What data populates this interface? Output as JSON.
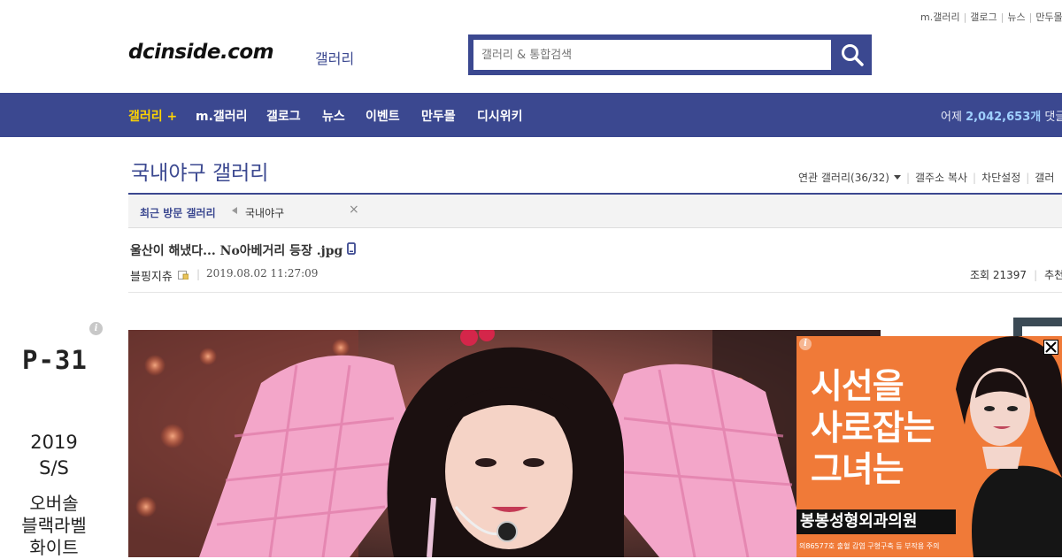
{
  "util_links": [
    "m.갤러리",
    "갤로그",
    "뉴스",
    "만두몰"
  ],
  "logo": {
    "main": "dcinside.com",
    "sub": "갤러리"
  },
  "search": {
    "placeholder": "갤러리 & 통합검색"
  },
  "nav": {
    "items": [
      "갤러리 +",
      "m.갤러리",
      "갤로그",
      "뉴스",
      "이벤트",
      "만두몰",
      "디시위키"
    ],
    "stats_label": "어제",
    "stats_value": "2,042,653개",
    "stats_suffix": "댓글"
  },
  "gallery": {
    "title": "국내야구 갤러리",
    "tools": {
      "related": "연관 갤러리(36/32)",
      "copy": "갤주소 복사",
      "block": "차단설정",
      "more": "갤러"
    }
  },
  "recent": {
    "label": "최근 방문 갤러리",
    "item": "국내야구",
    "close": "×"
  },
  "post": {
    "title": "울산이 해냈다... No아베거리 등장 .jpg",
    "author": "블핑지츄",
    "date": "2019.08.02 11:27:09",
    "views_label": "조회 21397",
    "recommend_label": "추천"
  },
  "left_ad": {
    "info": "i",
    "brand": "P-31",
    "year": [
      "2019",
      "S/S"
    ],
    "text": [
      "오버솔",
      "블랙라벨",
      "화이트"
    ]
  },
  "right_ad": {
    "info": "i",
    "headline": [
      "시선을",
      "사로잡는",
      "그녀는"
    ],
    "clinic": "봉봉성형외과의원",
    "fine_print": "의86577호 출혈 감염 구형구축 등 부작용 주의"
  },
  "colors": {
    "brand": "#3b4890",
    "nav_active": "#ffd400",
    "ad_orange": "#f07a38"
  }
}
